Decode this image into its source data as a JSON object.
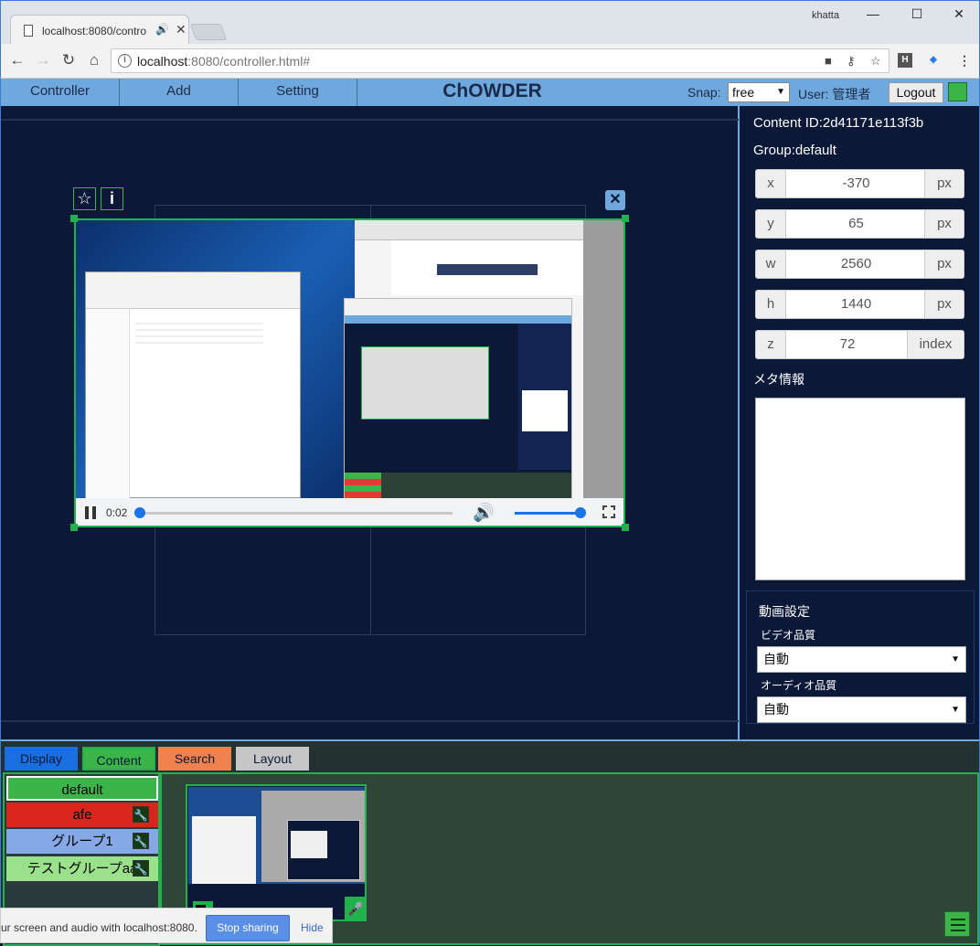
{
  "browser": {
    "tab_title": "localhost:8080/contro",
    "profile_name": "khatta",
    "url_host": "localhost",
    "url_path": ":8080/controller.html#",
    "minimize": "—",
    "maximize": "☐",
    "close": "✕"
  },
  "app": {
    "title": "ChOWDER",
    "menu": [
      "Controller",
      "Add",
      "Setting"
    ],
    "snap_label": "Snap:",
    "snap_value": "free",
    "user_label": "User: 管理者",
    "logout": "Logout"
  },
  "video": {
    "time": "0:02",
    "progress": 0.0,
    "volume": 1.0
  },
  "properties": {
    "content_id": "Content ID:2d41171e113f3b",
    "group": "Group:default",
    "fields": [
      {
        "label": "x",
        "value": "-370",
        "unit": "px"
      },
      {
        "label": "y",
        "value": "65",
        "unit": "px"
      },
      {
        "label": "w",
        "value": "2560",
        "unit": "px"
      },
      {
        "label": "h",
        "value": "1440",
        "unit": "px"
      },
      {
        "label": "z",
        "value": "72",
        "unit": "index"
      }
    ],
    "meta_label": "メタ情報",
    "video_settings_title": "動画設定",
    "video_quality_label": "ビデオ品質",
    "video_quality_value": "自動",
    "audio_quality_label": "オーディオ品質",
    "audio_quality_value": "自動"
  },
  "bottom_tabs": [
    {
      "label": "Display",
      "color": "#1a6fe0"
    },
    {
      "label": "Content",
      "color": "#3bb44a"
    },
    {
      "label": "Search",
      "color": "#f0824e"
    },
    {
      "label": "Layout",
      "color": "#c6c6c6"
    }
  ],
  "groups": [
    {
      "label": "default",
      "color": "#3bb44a"
    },
    {
      "label": "afe",
      "color": "#d9261c"
    },
    {
      "label": "グループ1",
      "color": "#86a8e6"
    },
    {
      "label": "テストグループaa",
      "color": "#9be08a"
    }
  ],
  "share_bar": {
    "text": "ur screen and audio with localhost:8080.",
    "stop": "Stop sharing",
    "hide": "Hide"
  },
  "colors": {
    "accent": "#6fa8dc",
    "selection": "#22b14c",
    "background": "#0b1838"
  }
}
